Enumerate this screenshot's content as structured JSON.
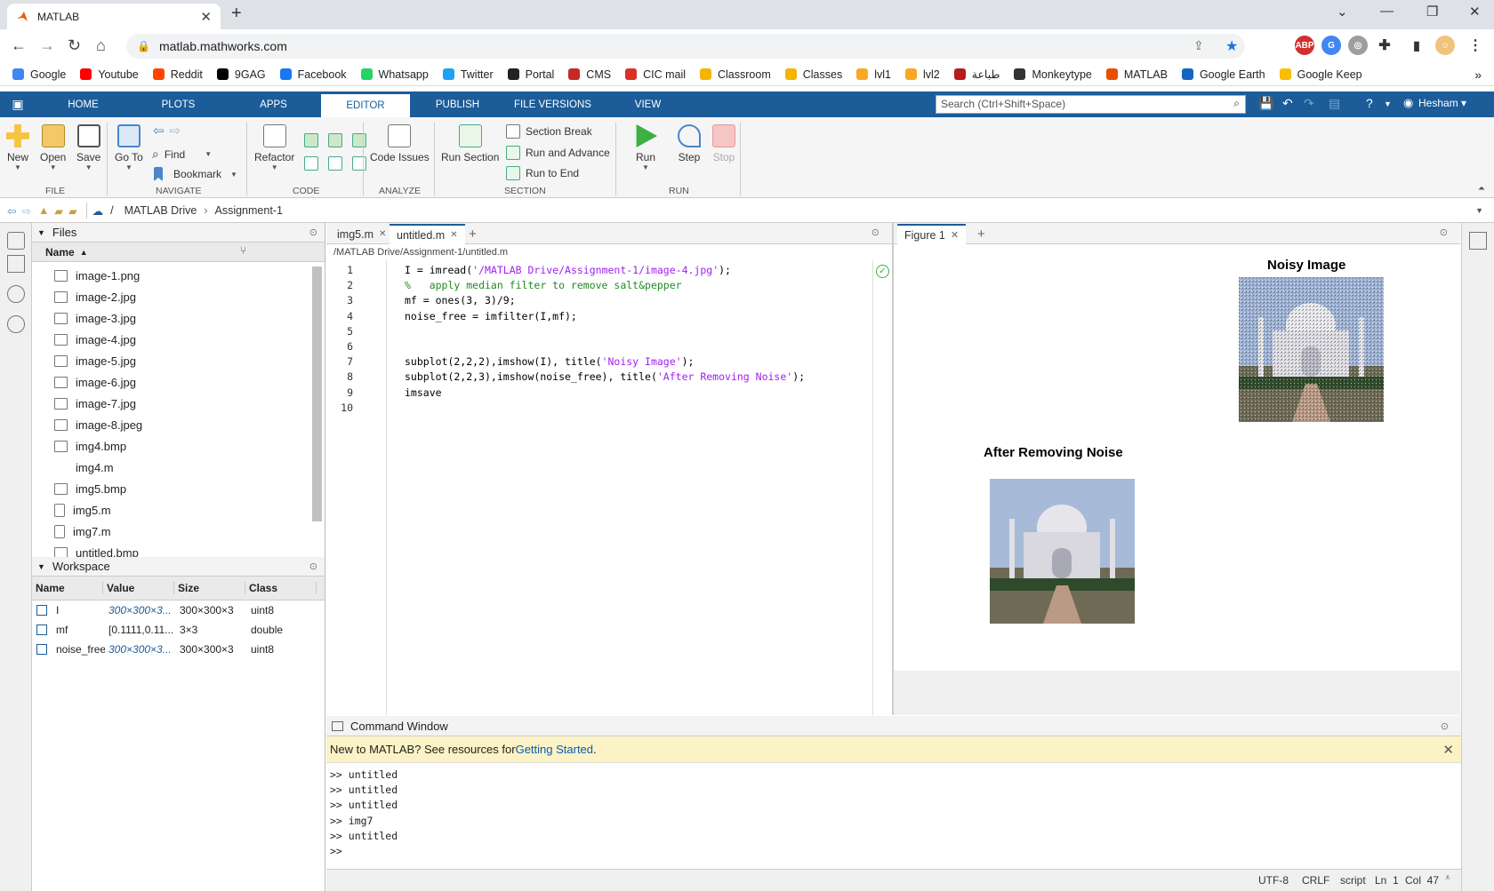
{
  "browser": {
    "tab_title": "MATLAB",
    "url": "matlab.mathworks.com",
    "bookmarks": [
      {
        "label": "Google",
        "color": "#4285f4"
      },
      {
        "label": "Youtube",
        "color": "#ff0000"
      },
      {
        "label": "Reddit",
        "color": "#ff4500"
      },
      {
        "label": "9GAG",
        "color": "#000000"
      },
      {
        "label": "Facebook",
        "color": "#1877f2"
      },
      {
        "label": "Whatsapp",
        "color": "#25d366"
      },
      {
        "label": "Twitter",
        "color": "#1da1f2"
      },
      {
        "label": "Portal",
        "color": "#222222"
      },
      {
        "label": "CMS",
        "color": "#c62828"
      },
      {
        "label": "CIC mail",
        "color": "#d93025"
      },
      {
        "label": "Classroom",
        "color": "#f4b400"
      },
      {
        "label": "Classes",
        "color": "#f4b400"
      },
      {
        "label": "lvl1",
        "color": "#f9a825"
      },
      {
        "label": "lvl2",
        "color": "#f9a825"
      },
      {
        "label": "طباعة",
        "color": "#b71c1c"
      },
      {
        "label": "Monkeytype",
        "color": "#333333"
      },
      {
        "label": "MATLAB",
        "color": "#e65100"
      },
      {
        "label": "Google Earth",
        "color": "#1565c0"
      },
      {
        "label": "Google Keep",
        "color": "#fbbc04"
      }
    ],
    "more_bookmarks": "»"
  },
  "matlab": {
    "tabs": [
      "HOME",
      "PLOTS",
      "APPS",
      "EDITOR",
      "PUBLISH",
      "FILE VERSIONS",
      "VIEW"
    ],
    "active_tab": "EDITOR",
    "search_placeholder": "Search (Ctrl+Shift+Space)",
    "user": "Hesham",
    "ribbon": {
      "new": "New",
      "open": "Open",
      "save": "Save",
      "file_group": "FILE",
      "goto": "Go To",
      "find": "Find",
      "bookmark": "Bookmark",
      "navigate_group": "NAVIGATE",
      "refactor": "Refactor",
      "code_group": "CODE",
      "code_issues": "Code Issues",
      "analyze_group": "ANALYZE",
      "run_section": "Run Section",
      "section_break": "Section Break",
      "run_and_advance": "Run and Advance",
      "run_to_end": "Run to End",
      "section_group": "SECTION",
      "run": "Run",
      "step": "Step",
      "stop": "Stop",
      "run_group": "RUN"
    },
    "path": {
      "sep": "/",
      "drive": "MATLAB Drive",
      "folder": "Assignment-1"
    },
    "files": {
      "title": "Files",
      "col_name": "Name",
      "items": [
        {
          "name": "image-1.png",
          "icon": "image-file-icon"
        },
        {
          "name": "image-2.jpg",
          "icon": "image-file-icon"
        },
        {
          "name": "image-3.jpg",
          "icon": "image-file-icon"
        },
        {
          "name": "image-4.jpg",
          "icon": "image-file-icon"
        },
        {
          "name": "image-5.jpg",
          "icon": "image-file-icon"
        },
        {
          "name": "image-6.jpg",
          "icon": "image-file-icon"
        },
        {
          "name": "image-7.jpg",
          "icon": "image-file-icon"
        },
        {
          "name": "image-8.jpeg",
          "icon": "image-file-icon"
        },
        {
          "name": "img4.bmp",
          "icon": "image-file-icon"
        },
        {
          "name": "img4.m",
          "icon": "none"
        },
        {
          "name": "img5.bmp",
          "icon": "image-file-icon"
        },
        {
          "name": "img5.m",
          "icon": "script-file-icon"
        },
        {
          "name": "img7.m",
          "icon": "script-file-icon"
        },
        {
          "name": "untitled.bmp",
          "icon": "image-file-icon"
        }
      ]
    },
    "workspace": {
      "title": "Workspace",
      "cols": [
        "Name",
        "Value",
        "Size",
        "Class"
      ],
      "rows": [
        {
          "name": "I",
          "value": "300×300×3...",
          "size": "300×300×3",
          "class": "uint8",
          "italic": true
        },
        {
          "name": "mf",
          "value": "[0.1111,0.11...",
          "size": "3×3",
          "class": "double",
          "italic": false
        },
        {
          "name": "noise_free",
          "value": "300×300×3...",
          "size": "300×300×3",
          "class": "uint8",
          "italic": true
        }
      ]
    },
    "editor": {
      "tabs": [
        "img5.m",
        "untitled.m"
      ],
      "active": "untitled.m",
      "file_path": "/MATLAB Drive/Assignment-1/untitled.m",
      "line_numbers": [
        "1",
        "2",
        "3",
        "4",
        "5",
        "6",
        "7",
        "8",
        "9",
        "10"
      ],
      "lines": [
        [
          {
            "t": "I = imread(",
            "c": "code"
          },
          {
            "t": "'/MATLAB Drive/Assignment-1/image-4.jpg'",
            "c": "str"
          },
          {
            "t": ");",
            "c": "code"
          }
        ],
        [
          {
            "t": "%   apply median filter to remove salt&pepper",
            "c": "cmt"
          }
        ],
        [
          {
            "t": "mf = ones(3, 3)/9;",
            "c": "code"
          }
        ],
        [
          {
            "t": "noise_free = imfilter(I,mf);",
            "c": "code"
          }
        ],
        [],
        [],
        [
          {
            "t": "subplot(2,2,2),imshow(I), title(",
            "c": "code"
          },
          {
            "t": "'Noisy Image'",
            "c": "str"
          },
          {
            "t": ");",
            "c": "code"
          }
        ],
        [
          {
            "t": "subplot(2,2,3),imshow(noise_free), title(",
            "c": "code"
          },
          {
            "t": "'After Removing Noise'",
            "c": "str"
          },
          {
            "t": ");",
            "c": "code"
          }
        ],
        [
          {
            "t": "imsave",
            "c": "code"
          }
        ],
        []
      ]
    },
    "figure": {
      "tab": "Figure 1",
      "titles": {
        "noisy": "Noisy Image",
        "clean": "After Removing Noise"
      }
    },
    "command": {
      "title": "Command Window",
      "notice_prefix": "New to MATLAB? See resources for ",
      "notice_link": "Getting Started",
      "notice_suffix": ".",
      "lines": [
        ">> untitled",
        ">> untitled",
        ">> untitled",
        ">> img7",
        ">> untitled",
        ">>"
      ]
    },
    "status": {
      "encoding": "UTF-8",
      "eol": "CRLF",
      "type": "script",
      "ln": "Ln  1",
      "col": "Col  47"
    }
  }
}
